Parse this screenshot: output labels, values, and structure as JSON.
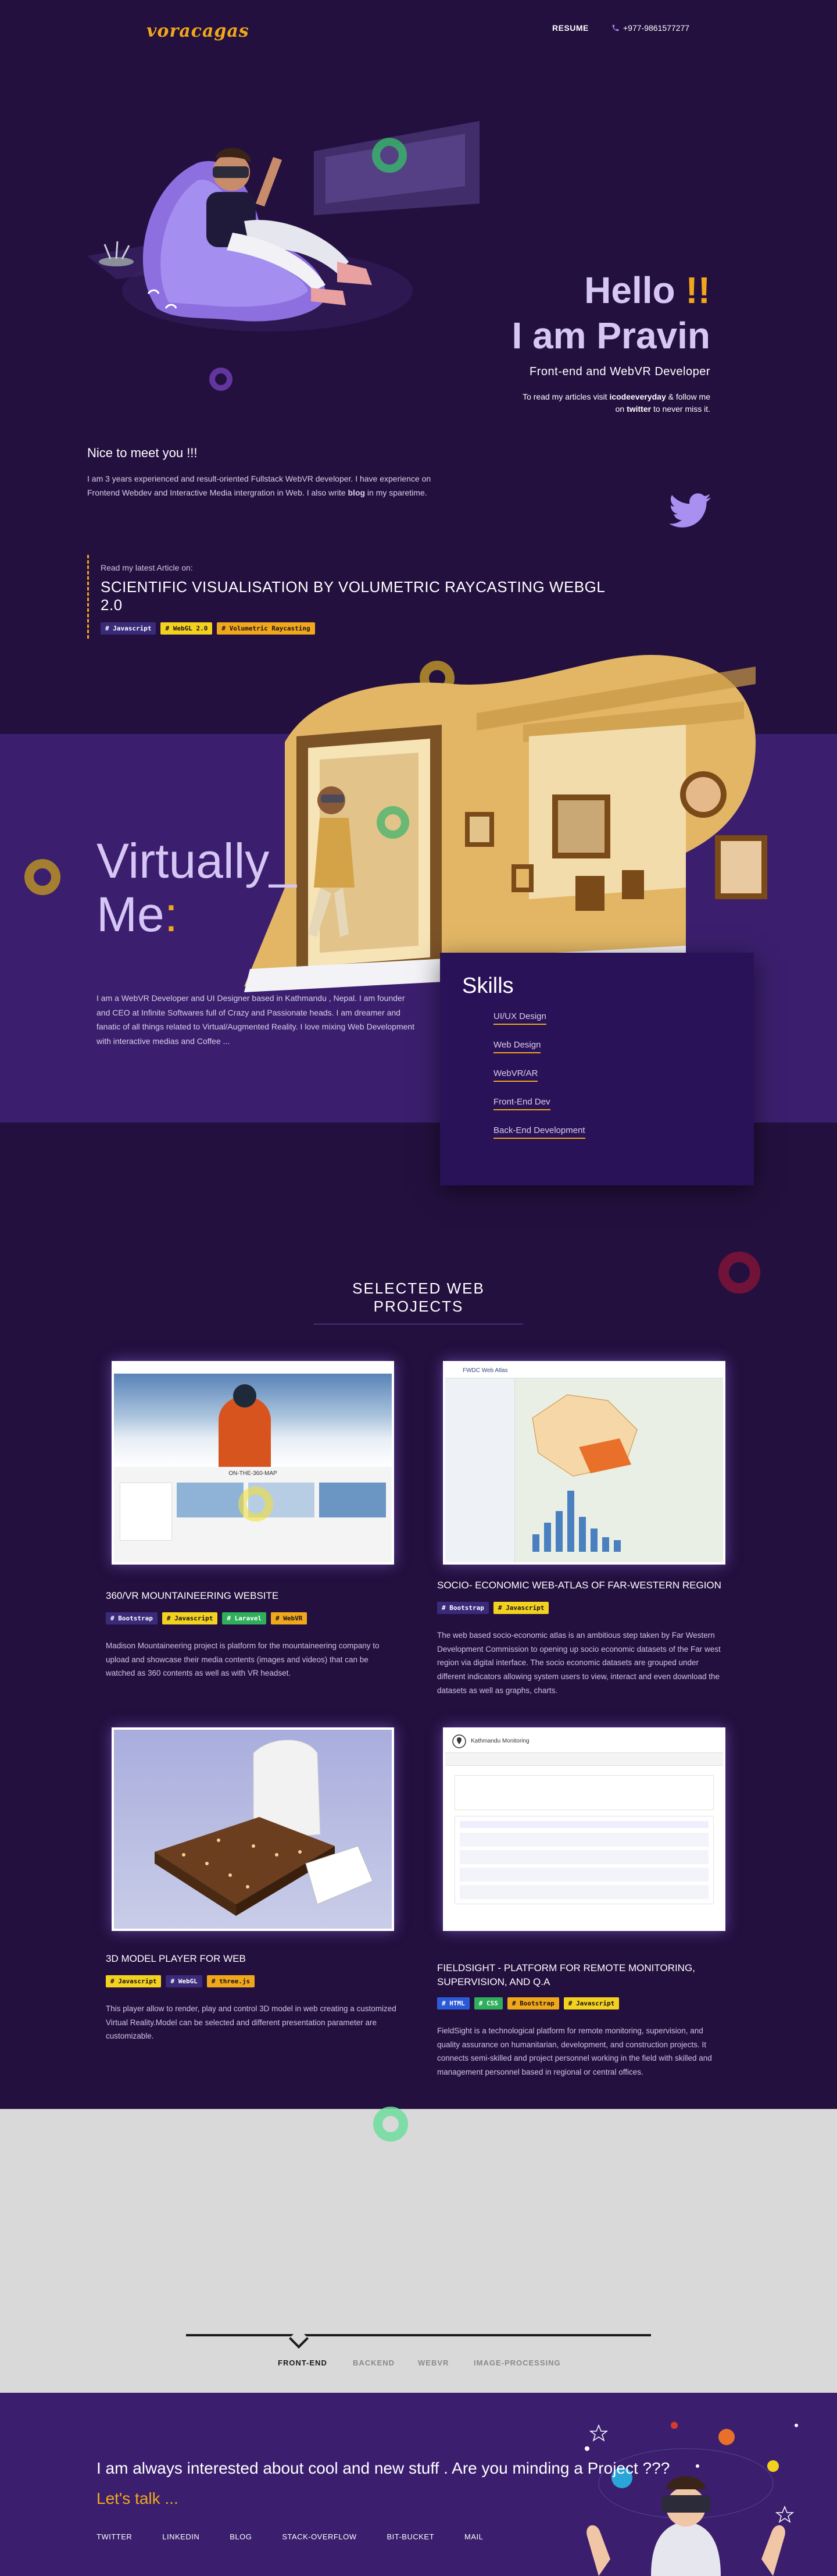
{
  "header": {
    "logo": "voracagas",
    "resume": "RESUME",
    "phone": "+977-9861577277"
  },
  "hero": {
    "hello": "Hello",
    "bang": "!!",
    "name": "I am Pravin",
    "role": "Front-end and WebVR Developer",
    "note_pre": "To read my articles visit ",
    "note_blog": "icodeeveryday",
    "note_mid": " & follow me on ",
    "note_tw": "twitter",
    "note_post": " to never miss it."
  },
  "intro": {
    "title": "Nice to meet you !!!",
    "text_pre": "I am 3 years experienced and result-oriented Fullstack WebVR developer. I have experience on Frontend Webdev and Interactive Media intergration in Web. I also write ",
    "text_blog": "blog",
    "text_post": " in my sparetime."
  },
  "article": {
    "label": "Read my latest Article on:",
    "title": "SCIENTIFIC VISUALISATION BY VOLUMETRIC RAYCASTING WEBGL 2.0",
    "tags": [
      "# Javascript",
      "# WebGL 2.0",
      "# Volumetric Raycasting"
    ]
  },
  "about": {
    "title_line1": "Virtually",
    "title_underscore": "_",
    "title_line2": "Me",
    "title_colon": ":",
    "description": "I am a WebVR Developer and UI Designer based in Kathmandu , Nepal. I am founder and CEO at Infinite Softwares full of Crazy and Passionate heads. I am dreamer and fanatic of all things related to Virtual/Augmented Reality. I love mixing Web Development with interactive medias and Coffee ..."
  },
  "skills": {
    "title": "Skills",
    "items": [
      "UI/UX Design",
      "Web Design",
      "WebVR/AR",
      "Front-End Dev",
      "Back-End Development"
    ]
  },
  "projects": {
    "heading": "SELECTED WEB PROJECTS",
    "items": [
      {
        "title": "360/VR MOUNTAINEERING WEBSITE",
        "tags": [
          "# Bootstrap",
          "# Javascript",
          "# Laravel",
          "# WebVR"
        ],
        "description": "Madison Mountaineering project is platform for the mountaineering company to upload and showcase their media contents (images and videos) that can be watched as 360 contents as well as with VR headset.",
        "thumb_heading": "ON-THE-360-MAP"
      },
      {
        "title": "SOCIO- ECONOMIC WEB-ATLAS OF FAR-WESTERN REGION",
        "tags": [
          "# Bootstrap",
          "# Javascript"
        ],
        "description": "The web based socio-economic atlas is an ambitious step taken by Far Western Development Commission to opening up socio economic datasets of the Far west region via digital interface. The socio economic datasets are grouped under different indicators allowing system users to view, interact and even download the datasets as well as graphs, charts.",
        "thumb_heading": "FWDC Web Atlas"
      },
      {
        "title": "3D MODEL PLAYER FOR WEB",
        "tags": [
          "# Javascript",
          "# WebGL",
          "# three.js"
        ],
        "description": "This player allow to render, play and control 3D model in web creating a customized Virtual Reality.Model can be selected and different presentation parameter are customizable."
      },
      {
        "title": "FIELDSIGHT - PLATFORM FOR REMOTE MONITORING, SUPERVISION, AND Q.A",
        "tags": [
          "# HTML",
          "# CSS",
          "# Bootstrap",
          "# Javascript"
        ],
        "description": "FieldSight is a technological platform for remote monitoring, supervision, and quality assurance on humanitarian, development, and construction projects. It connects semi-skilled and project personnel working in the field with skilled and management personnel based in regional or central offices.",
        "thumb_heading": "Kathmandu Monitoring"
      }
    ]
  },
  "portfolio_tabs": [
    "FRONT-END",
    "BACKEND",
    "WEBVR",
    "IMAGE-PROCESSING"
  ],
  "footer": {
    "cta": "I am always interested about cool and new stuff . Are you minding a Project ???",
    "cta_link": "Let's talk ...",
    "links": [
      "TWITTER",
      "LINKEDIN",
      "BLOG",
      "STACK-OVERFLOW",
      "BIT-BUCKET",
      "MAIL"
    ]
  },
  "colors": {
    "background": "#24103f",
    "band": "#3b1f6e",
    "accent": "#f0a81a",
    "lavender": "#d6c6f5"
  }
}
